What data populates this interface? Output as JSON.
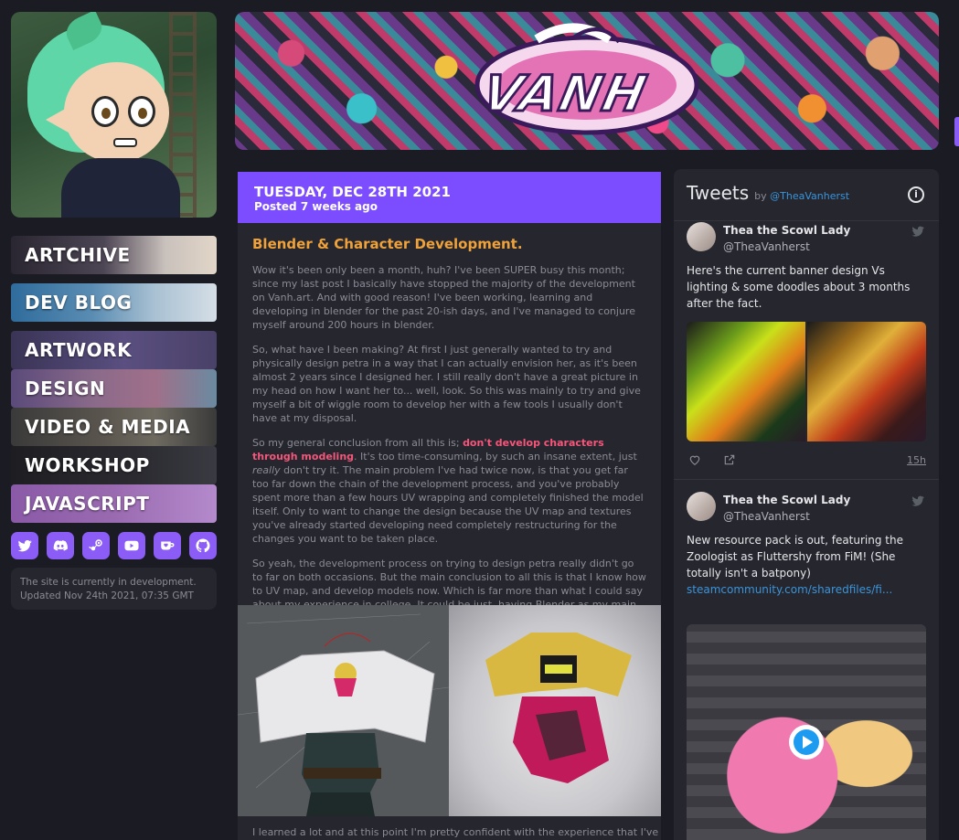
{
  "nav": {
    "items": [
      {
        "label": "ARTCHIVE"
      },
      {
        "label": "DEV BLOG"
      },
      {
        "label": "ARTWORK"
      },
      {
        "label": "DESIGN"
      },
      {
        "label": "VIDEO & MEDIA"
      },
      {
        "label": "WORKSHOP"
      },
      {
        "label": "JAVASCRIPT"
      }
    ]
  },
  "social": {
    "icons": [
      "twitter-icon",
      "discord-icon",
      "steam-icon",
      "youtube-icon",
      "kofi-icon",
      "github-icon"
    ]
  },
  "dev_note": {
    "line1": "The site is currently in development.",
    "line2": "Updated Nov 24th 2021, 07:35 GMT"
  },
  "post": {
    "date": "TUESDAY, DEC 28TH 2021",
    "posted_ago": "Posted 7 weeks ago",
    "title": "Blender & Character Development.",
    "p1": "Wow it's been only been a month, huh? I've been SUPER busy this month; since my last post I basically have stopped the majority of the development on Vanh.art. And with good reason! I've been working, learning and developing in blender for the past 20-ish days, and I've managed to conjure myself around 200 hours in blender.",
    "p2": "So, what have I been making? At first I just generally wanted to try and physically design petra in a way that I can actually envision her, as it's been almost 2 years since I designed her. I still really don't have a great picture in my head on how I want her to... well, look. So this was mainly to try and give myself a bit of wiggle room to develop her with a few tools I usually don't have at my disposal.",
    "p3_before": "So my general conclusion from all this is; ",
    "p3_highlight": "don't develop characters through modeling",
    "p3_mid": ". It's too time-consuming, by such an insane extent, just ",
    "p3_italic": "really",
    "p3_after": " don't try it. The main problem I've had twice now, is that you get far too far down the chain of the development process, and you've probably spent more than a few hours UV wrapping and completely finished the model itself. Only to want to change the design because the UV map and textures you've already started developing need completely restructuring for the changes you want to be taken place.",
    "p4": "So yeah, the development process on trying to design petra really didn't go to far on both occasions. But the main conclusion to all this is that I know how to UV map, and develop models now. Which is far more than what I could say about my experience in college. It could be just, having Blender as my main tool of choice rather than Maya? I'm not entirely sure, but this time around felt way more intuitive as much as a cumbersome project it ended up being overall.",
    "tail": "I learned a lot and at this point I'm pretty confident with the experience that I've"
  },
  "tweets": {
    "title": "Tweets",
    "by": "by",
    "handle": "@TheaVanherst",
    "info_symbol": "i",
    "items": [
      {
        "name": "Thea the Scowl Lady",
        "handle": "@TheaVanherst",
        "text": "Here's the current banner design Vs lighting & some doodles about 3 months after the fact.",
        "time": "15h"
      },
      {
        "name": "Thea the Scowl Lady",
        "handle": "@TheaVanherst",
        "text": "New resource pack is out, featuring the Zoologist as Fluttershy from FiM! (She totally isn't a batpony)",
        "link": "steamcommunity.com/sharedfiles/fi..."
      }
    ]
  },
  "colors": {
    "accent": "#7c4dff",
    "title_orange": "#f0a23a",
    "highlight_pink": "#f5567a",
    "link_blue": "#3b94d9",
    "background": "#1b1c23",
    "panel": "#25262e"
  }
}
